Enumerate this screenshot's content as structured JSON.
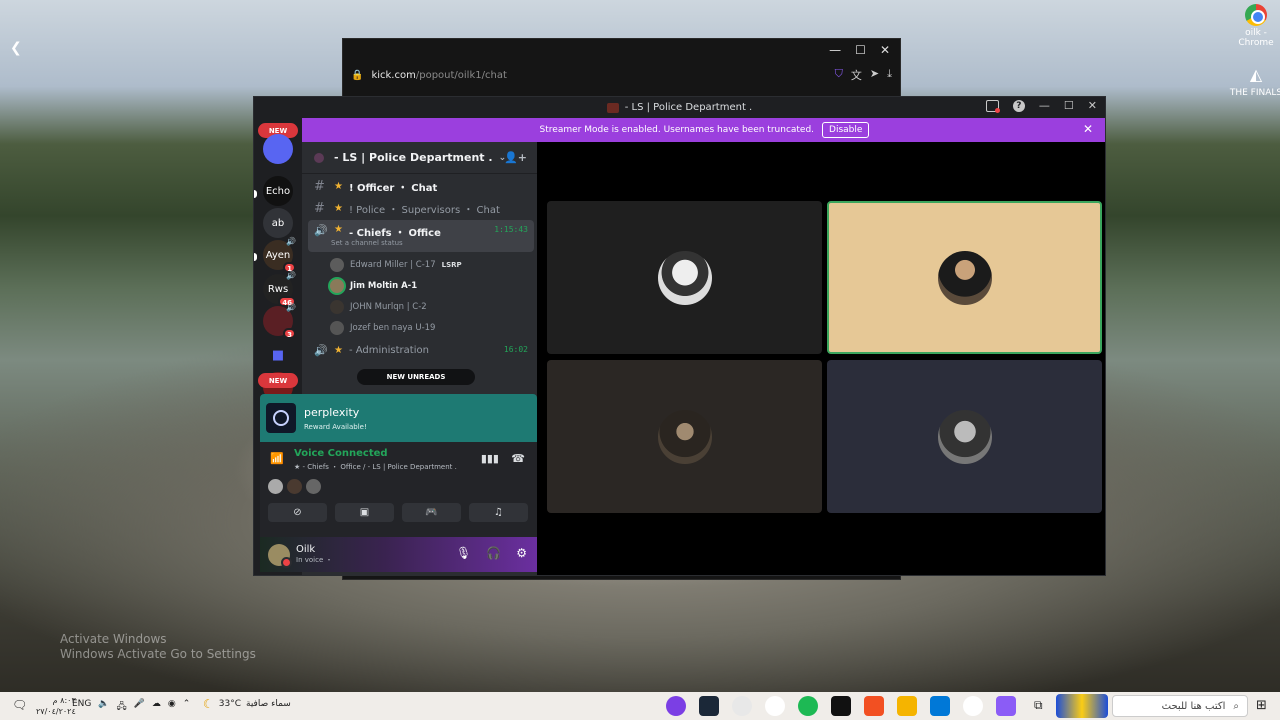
{
  "desktop": {
    "icons": [
      {
        "label": "oilk - Chrome"
      },
      {
        "label": "THE FINALS"
      }
    ],
    "watermark_line1": "Activate Windows",
    "watermark_line2": "Windows Activate Go to Settings"
  },
  "browser": {
    "url_host": "kick.com",
    "url_path": "/popout/oilk1/chat",
    "controls": {
      "minimize": "—",
      "maximize": "☐",
      "close": "✕"
    }
  },
  "discord": {
    "window_title": "- LS | Police Department .",
    "banner": {
      "text": "Streamer Mode is enabled. Usernames have been truncated.",
      "button": "Disable"
    },
    "guilds": {
      "new_top": "NEW",
      "new_bottom": "NEW",
      "items": [
        {
          "label": "Echo",
          "badge": ""
        },
        {
          "label": "ab",
          "badge": ""
        },
        {
          "label": "Ayen",
          "badge": "1"
        },
        {
          "label": "Rws",
          "badge": "46"
        },
        {
          "label": "",
          "badge": "3"
        }
      ]
    },
    "server_name": "- LS | Police Department .",
    "channels": [
      {
        "name": "! Officer ・ Chat",
        "time": "",
        "status": ""
      },
      {
        "name": "! Police ・ Supervisors ・ Chat",
        "time": "",
        "status": ""
      },
      {
        "name": "- Chiefs ・ Office",
        "time": "1:15:43",
        "status": "Set a channel status"
      },
      {
        "name": "- Administration",
        "time": "16:02",
        "status": ""
      }
    ],
    "voice_users": [
      {
        "name": "Edward Miller | C-17",
        "tag": "LSRP"
      },
      {
        "name": "Jim Moltin A-1",
        "tag": ""
      },
      {
        "name": "JOHN Murlqn | C-2",
        "tag": ""
      },
      {
        "name": "Jozef ben naya U-19",
        "tag": ""
      }
    ],
    "new_unreads": "NEW UNREADS",
    "promo": {
      "title": "perplexity",
      "subtitle": "Reward Available!"
    },
    "voice_panel": {
      "status": "Voice Connected",
      "channel": "★ - Chiefs ・ Office / - LS | Police Department ."
    },
    "user": {
      "name": "Oilk",
      "status": "In voice ・"
    }
  },
  "taskbar": {
    "clock_time": "٨:٠٣ م",
    "clock_date": "٢٧/٠٤/٢٠٢٤",
    "lang": "ENG",
    "temperature": "33°C",
    "weather": "سماء صافية",
    "search_placeholder": "اكتب هنا للبحث",
    "colors": [
      "#7b3fe4",
      "#1b2838",
      "#e8e8e8",
      "#ffffff",
      "#1db954",
      "#111111",
      "#f25022",
      "#f5b400",
      "#0078d7",
      "#ffffff",
      "#8b5cf6"
    ]
  }
}
